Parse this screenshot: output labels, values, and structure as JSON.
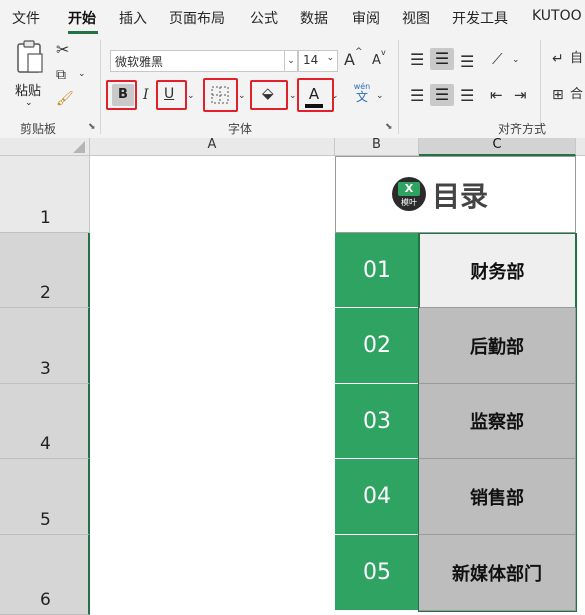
{
  "menu": {
    "items": [
      "文件",
      "开始",
      "插入",
      "页面布局",
      "公式",
      "数据",
      "审阅",
      "视图",
      "开发工具",
      "KUTOO"
    ],
    "active_index": 1
  },
  "ribbon": {
    "clipboard": {
      "paste_label": "粘贴",
      "group_label": "剪贴板"
    },
    "font": {
      "font_name": "微软雅黑",
      "font_size": "14",
      "grow_glyph": "A",
      "shrink_glyph": "A",
      "bold": "B",
      "italic": "I",
      "underline": "U",
      "font_color_glyph": "A",
      "phonetic_top": "wén",
      "phonetic_bottom": "文",
      "group_label": "字体"
    },
    "alignment": {
      "wrap_label": "自",
      "merge_label": "合",
      "group_label": "对齐方式"
    }
  },
  "sheet": {
    "columns": [
      "A",
      "B",
      "C"
    ],
    "selected_column": "C",
    "rows": [
      "1",
      "2",
      "3",
      "4",
      "5",
      "6"
    ],
    "title": "目录",
    "logo_text_top": "X",
    "logo_text_bottom": "模叶",
    "entries": [
      {
        "num": "01",
        "name": "财务部"
      },
      {
        "num": "02",
        "name": "后勤部"
      },
      {
        "num": "03",
        "name": "监察部"
      },
      {
        "num": "04",
        "name": "销售部"
      },
      {
        "num": "05",
        "name": "新媒体部门"
      }
    ]
  },
  "colors": {
    "excel_green": "#217346",
    "number_fill": "#2ea362",
    "name_fill": "#bdbdbd",
    "highlight_box": "#e0202a"
  }
}
